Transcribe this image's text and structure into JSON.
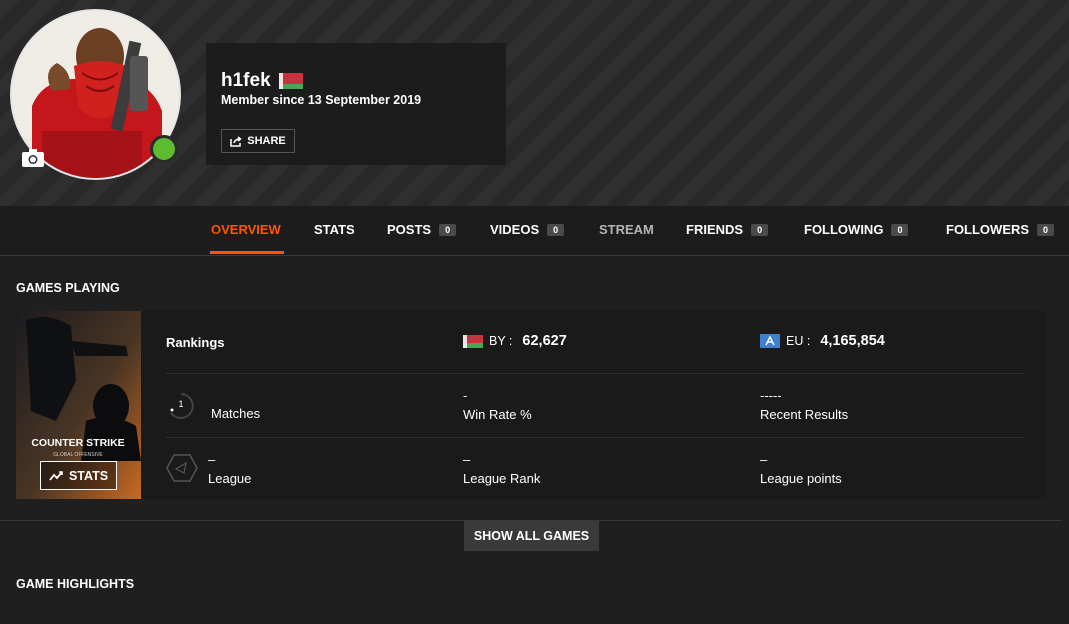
{
  "profile": {
    "username": "h1fek",
    "member_since": "Member since 13 September 2019",
    "share_label": "SHARE",
    "status_color": "#5dbb2f"
  },
  "nav": {
    "items": [
      {
        "label": "OVERVIEW",
        "count": null
      },
      {
        "label": "STATS",
        "count": null
      },
      {
        "label": "POSTS",
        "count": "0"
      },
      {
        "label": "VIDEOS",
        "count": "0"
      },
      {
        "label": "STREAM",
        "count": null
      },
      {
        "label": "FRIENDS",
        "count": "0"
      },
      {
        "label": "FOLLOWING",
        "count": "0"
      },
      {
        "label": "FOLLOWERS",
        "count": "0"
      }
    ],
    "accent": "#ff5500"
  },
  "games_playing": {
    "title": "GAMES PLAYING",
    "game": {
      "cover_text": "COUNTER STRIKE",
      "stats_label": "STATS",
      "rankings_label": "Rankings",
      "region_by_label": "BY :",
      "region_by_value": "62,627",
      "region_eu_label": "EU :",
      "region_eu_value": "4,165,854",
      "matches_badge": "1",
      "matches_label": "Matches",
      "win_rate_value": "-",
      "win_rate_label": "Win Rate %",
      "recent_results_value": "-----",
      "recent_results_label": "Recent Results",
      "league_value": "–",
      "league_label": "League",
      "league_rank_value": "–",
      "league_rank_label": "League Rank",
      "league_points_value": "–",
      "league_points_label": "League points"
    }
  },
  "show_all_label": "SHOW ALL GAMES",
  "highlights_title": "GAME HIGHLIGHTS"
}
